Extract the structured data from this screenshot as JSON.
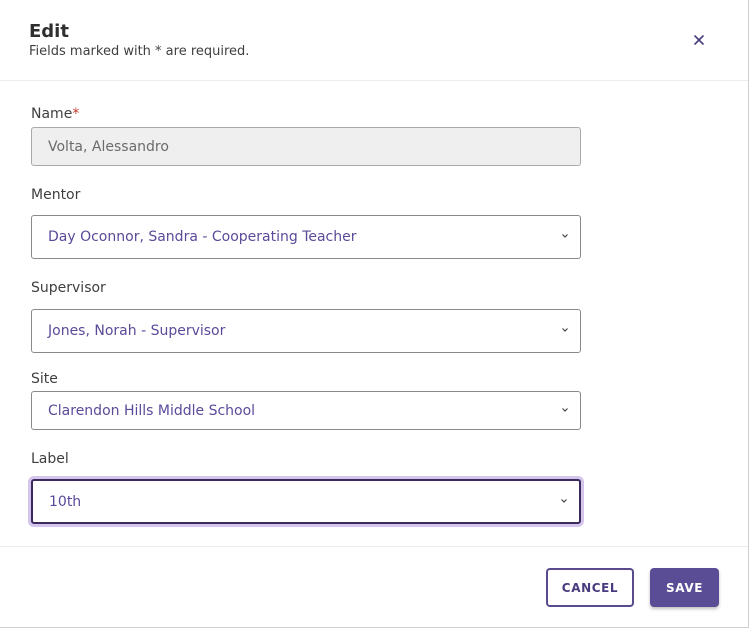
{
  "dialog": {
    "title": "Edit",
    "subtitle": "Fields marked with * are required.",
    "close_icon": "close-icon"
  },
  "fields": {
    "name": {
      "label": "Name",
      "required_marker": "*",
      "value": "Volta, Alessandro"
    },
    "mentor": {
      "label": "Mentor",
      "value": "Day Oconnor, Sandra - Cooperating Teacher"
    },
    "supervisor": {
      "label": "Supervisor",
      "value": "Jones, Norah - Supervisor"
    },
    "site": {
      "label": "Site",
      "value": "Clarendon Hills Middle School"
    },
    "label": {
      "label": "Label",
      "value": "10th"
    }
  },
  "footer": {
    "cancel_label": "CANCEL",
    "save_label": "SAVE"
  },
  "colors": {
    "accent": "#5a4d96",
    "required": "#c0392b",
    "focus_ring": "#805ac8"
  }
}
